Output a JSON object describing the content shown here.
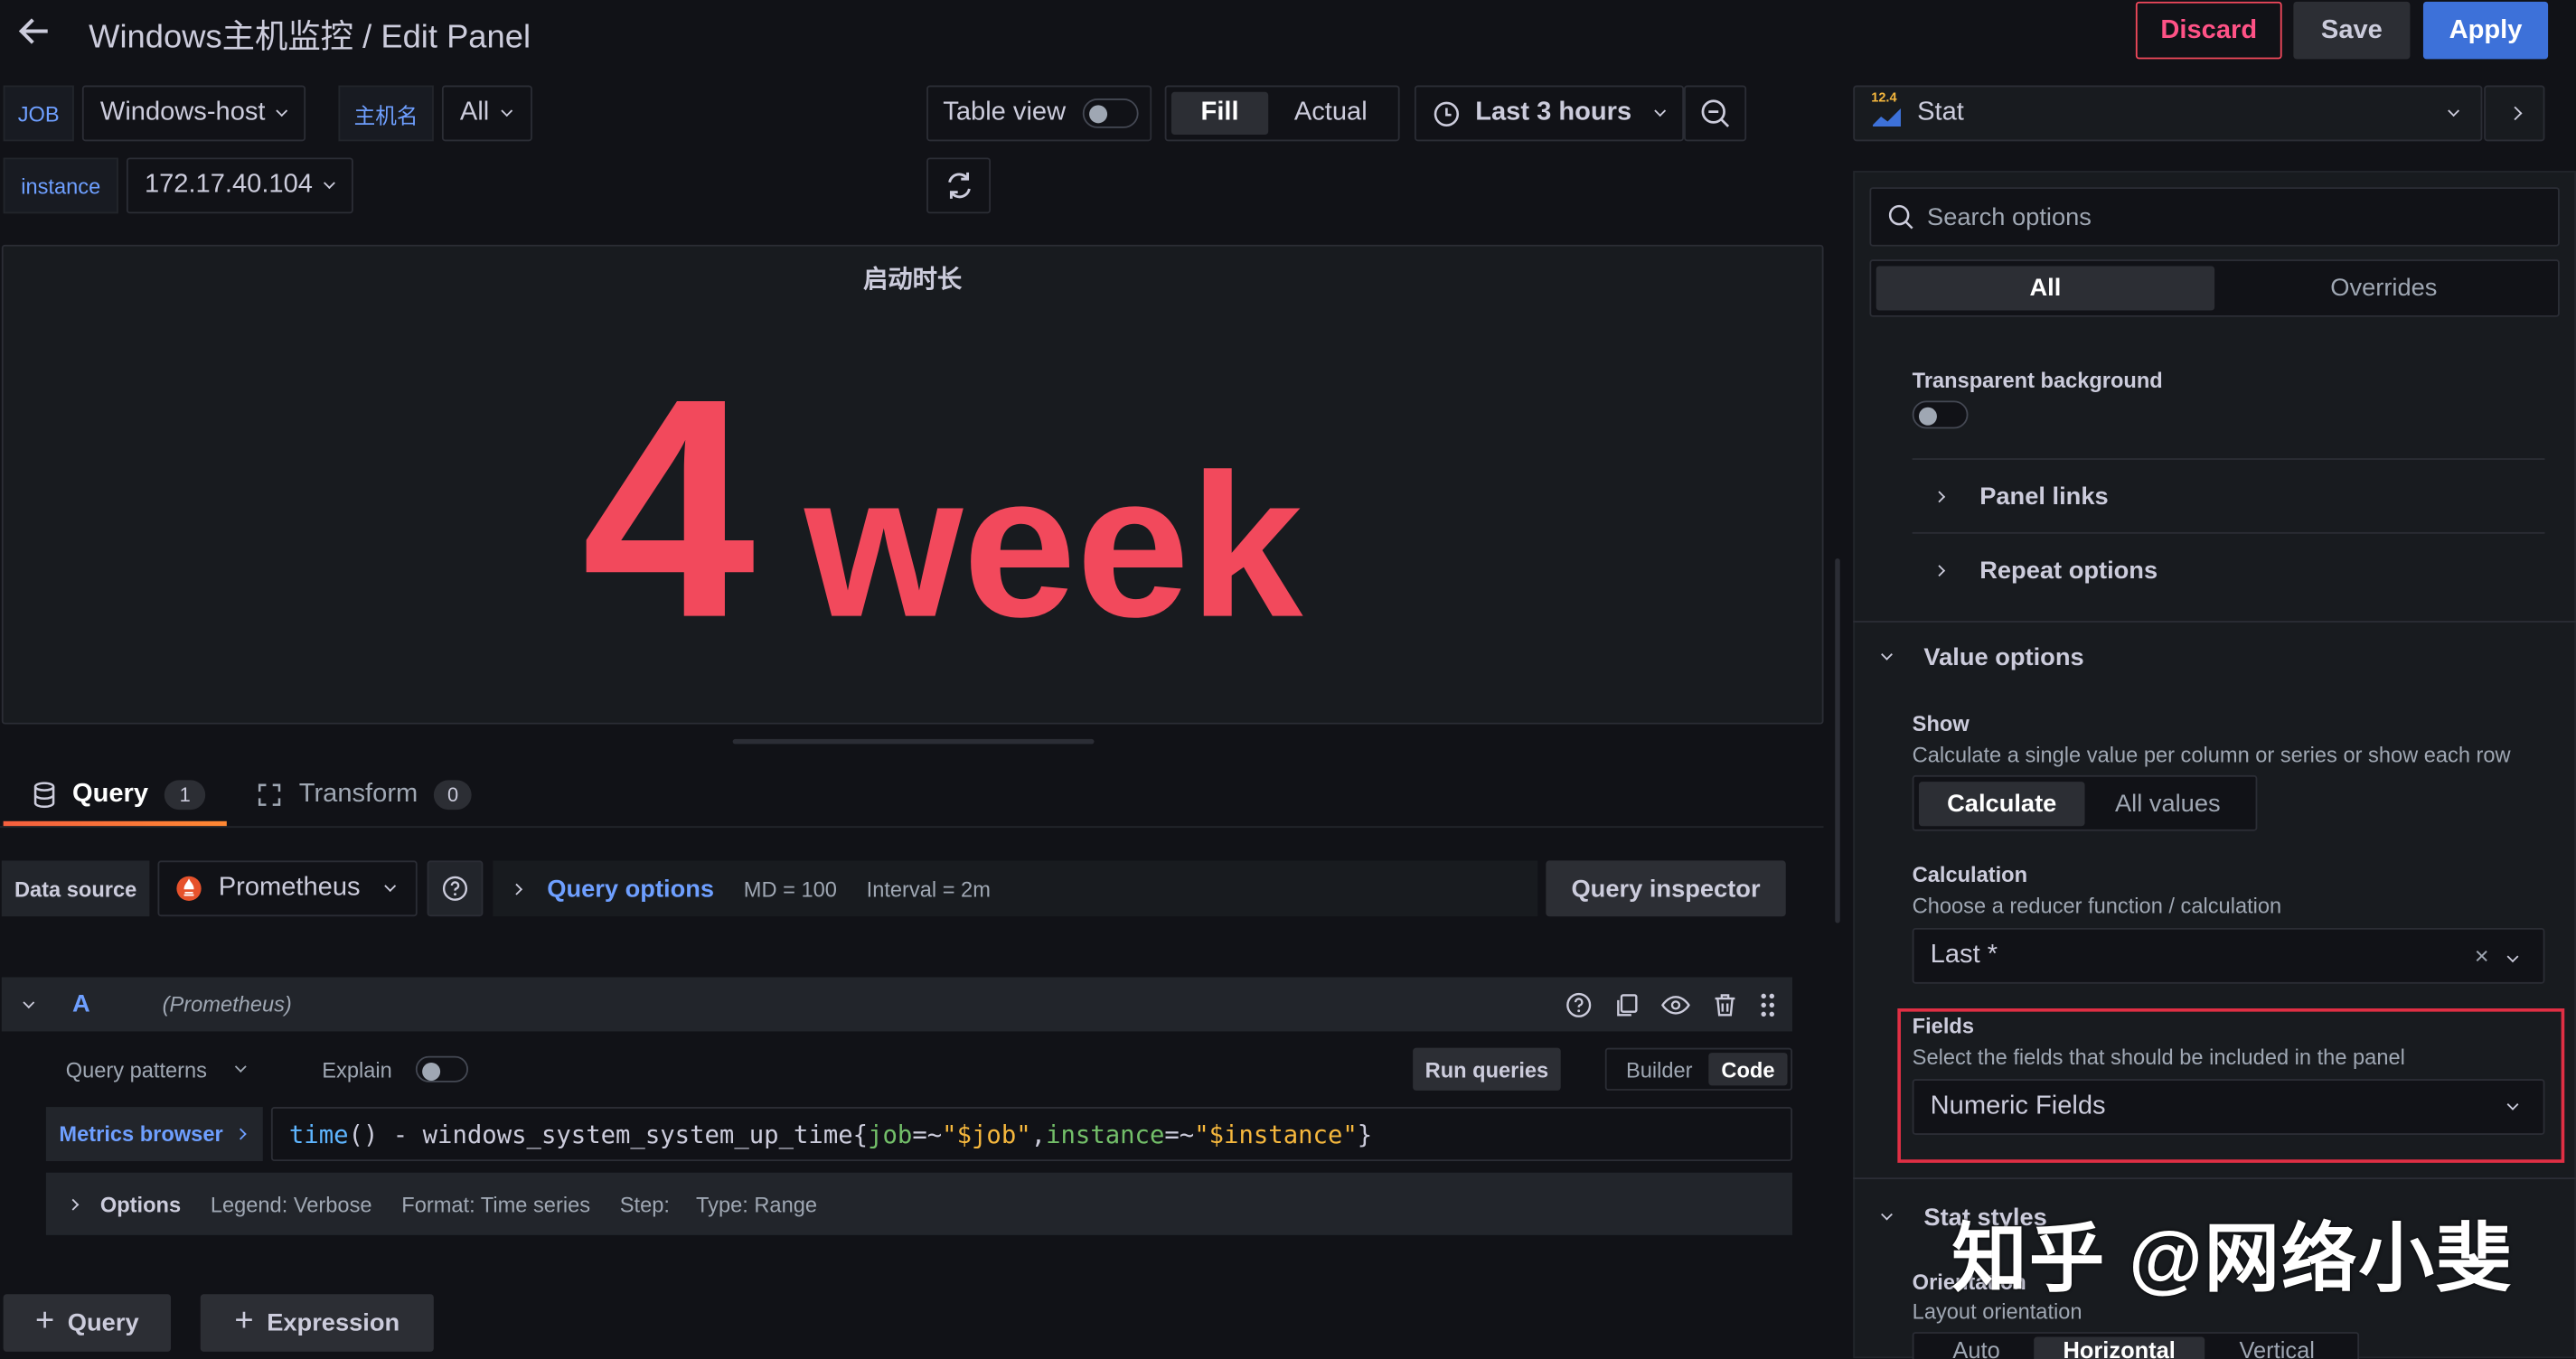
{
  "header": {
    "title": "Windows主机监控 / Edit Panel",
    "discard": "Discard",
    "save": "Save",
    "apply": "Apply"
  },
  "vars": {
    "job_label": "JOB",
    "job_value": "Windows-host",
    "host_label": "主机名",
    "host_value": "All",
    "instance_label": "instance",
    "instance_value": "172.17.40.104"
  },
  "toolbar": {
    "table_view": "Table view",
    "fill": "Fill",
    "actual": "Actual",
    "time_range": "Last 3 hours"
  },
  "viz": {
    "type": "Stat",
    "version": "12.4"
  },
  "panel": {
    "title": "启动时长",
    "value": "4",
    "unit": "week"
  },
  "query_tabs": {
    "query": "Query",
    "query_count": "1",
    "transform": "Transform",
    "transform_count": "0"
  },
  "datasource": {
    "label": "Data source",
    "name": "Prometheus",
    "query_options": "Query options",
    "md": "MD = 100",
    "interval": "Interval = 2m",
    "inspector": "Query inspector"
  },
  "query_a": {
    "ref": "A",
    "ds": "(Prometheus)",
    "patterns": "Query patterns",
    "explain": "Explain",
    "run": "Run queries",
    "builder": "Builder",
    "code": "Code",
    "metrics_browser": "Metrics browser",
    "expr": {
      "fn": "time",
      "p1": "()",
      "op": " - ",
      "metric": "windows_system_system_up_time",
      "b1": "{",
      "k1": "job",
      "eq1": "=~",
      "v1": "\"$job\"",
      "comma": ",",
      "k2": "instance",
      "eq2": "=~",
      "v2": "\"$instance\"",
      "b2": "}"
    },
    "options_label": "Options",
    "legend": "Legend: Verbose",
    "format": "Format: Time series",
    "step": "Step:",
    "type": "Type: Range"
  },
  "add": {
    "query": "Query",
    "expression": "Expression"
  },
  "options": {
    "search_placeholder": "Search options",
    "all": "All",
    "overrides": "Overrides",
    "transparent_bg": "Transparent background",
    "panel_links": "Panel links",
    "repeat_options": "Repeat options",
    "value_options": "Value options",
    "show": "Show",
    "show_desc": "Calculate a single value per column or series or show each row",
    "calculate": "Calculate",
    "all_values": "All values",
    "calculation": "Calculation",
    "calculation_desc": "Choose a reducer function / calculation",
    "calculation_value": "Last *",
    "fields": "Fields",
    "fields_desc": "Select the fields that should be included in the panel",
    "fields_value": "Numeric Fields",
    "stat_styles": "Stat styles",
    "orientation": "Orientation",
    "orientation_desc": "Layout orientation",
    "orient_auto": "Auto",
    "orient_h": "Horizontal",
    "orient_v": "Vertical"
  },
  "watermark": "知乎 @网络小斐",
  "colors": {
    "accent": "#3d71d9",
    "value_red": "#f2495c",
    "link_blue": "#6e9fff",
    "highlight": "#e02f44"
  }
}
